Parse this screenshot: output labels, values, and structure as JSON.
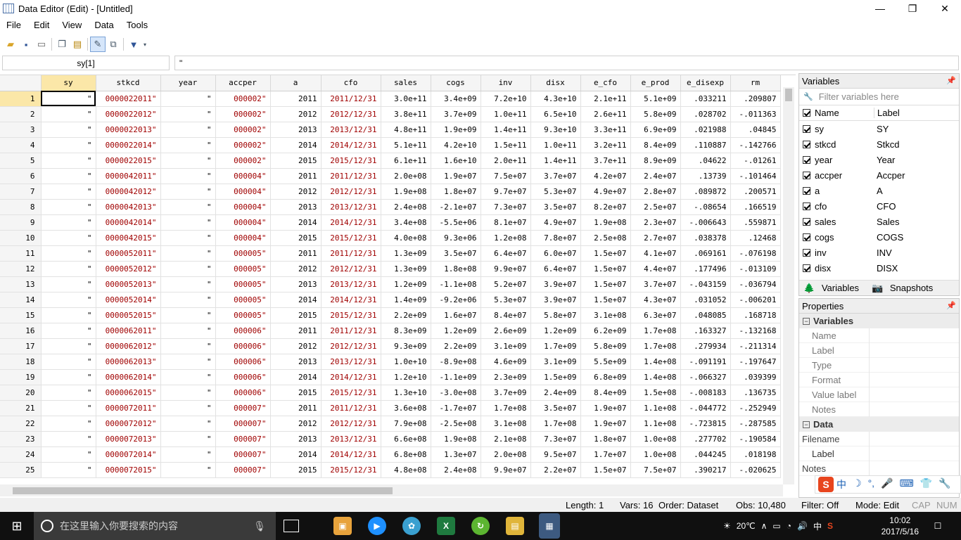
{
  "window": {
    "title": "Data Editor (Edit) - [Untitled]",
    "controls": [
      "—",
      "❐",
      "✕"
    ]
  },
  "menu": [
    "File",
    "Edit",
    "View",
    "Data",
    "Tools"
  ],
  "cellbar": {
    "name": "sy[1]",
    "value": "\""
  },
  "grid": {
    "columns": [
      "sy",
      "stkcd",
      "year",
      "accper",
      "a",
      "cfo",
      "sales",
      "cogs",
      "inv",
      "disx",
      "e_cfo",
      "e_prod",
      "e_disexp",
      "rm"
    ],
    "rows": [
      [
        "1",
        "\"",
        "0000022011\"",
        "\"",
        "000002\"",
        "2011",
        "2011/12/31",
        "3.0e+11",
        "3.4e+09",
        "7.2e+10",
        "4.3e+10",
        "2.1e+11",
        "5.1e+09",
        ".033211",
        ".209807"
      ],
      [
        "2",
        "\"",
        "0000022012\"",
        "\"",
        "000002\"",
        "2012",
        "2012/12/31",
        "3.8e+11",
        "3.7e+09",
        "1.0e+11",
        "6.5e+10",
        "2.6e+11",
        "5.8e+09",
        ".028702",
        "-.011363"
      ],
      [
        "3",
        "\"",
        "0000022013\"",
        "\"",
        "000002\"",
        "2013",
        "2013/12/31",
        "4.8e+11",
        "1.9e+09",
        "1.4e+11",
        "9.3e+10",
        "3.3e+11",
        "6.9e+09",
        ".021988",
        ".04845"
      ],
      [
        "4",
        "\"",
        "0000022014\"",
        "\"",
        "000002\"",
        "2014",
        "2014/12/31",
        "5.1e+11",
        "4.2e+10",
        "1.5e+11",
        "1.0e+11",
        "3.2e+11",
        "8.4e+09",
        ".110887",
        "-.142766"
      ],
      [
        "5",
        "\"",
        "0000022015\"",
        "\"",
        "000002\"",
        "2015",
        "2015/12/31",
        "6.1e+11",
        "1.6e+10",
        "2.0e+11",
        "1.4e+11",
        "3.7e+11",
        "8.9e+09",
        ".04622",
        "-.01261"
      ],
      [
        "6",
        "\"",
        "0000042011\"",
        "\"",
        "000004\"",
        "2011",
        "2011/12/31",
        "2.0e+08",
        "1.9e+07",
        "7.5e+07",
        "3.7e+07",
        "4.2e+07",
        "2.4e+07",
        ".13739",
        "-.101464"
      ],
      [
        "7",
        "\"",
        "0000042012\"",
        "\"",
        "000004\"",
        "2012",
        "2012/12/31",
        "1.9e+08",
        "1.8e+07",
        "9.7e+07",
        "5.3e+07",
        "4.9e+07",
        "2.8e+07",
        ".089872",
        ".200571"
      ],
      [
        "8",
        "\"",
        "0000042013\"",
        "\"",
        "000004\"",
        "2013",
        "2013/12/31",
        "2.4e+08",
        "-2.1e+07",
        "7.3e+07",
        "3.5e+07",
        "8.2e+07",
        "2.5e+07",
        "-.08654",
        ".166519"
      ],
      [
        "9",
        "\"",
        "0000042014\"",
        "\"",
        "000004\"",
        "2014",
        "2014/12/31",
        "3.4e+08",
        "-5.5e+06",
        "8.1e+07",
        "4.9e+07",
        "1.9e+08",
        "2.3e+07",
        "-.006643",
        ".559871"
      ],
      [
        "10",
        "\"",
        "0000042015\"",
        "\"",
        "000004\"",
        "2015",
        "2015/12/31",
        "4.0e+08",
        "9.3e+06",
        "1.2e+08",
        "7.8e+07",
        "2.5e+08",
        "2.7e+07",
        ".038378",
        ".12468"
      ],
      [
        "11",
        "\"",
        "0000052011\"",
        "\"",
        "000005\"",
        "2011",
        "2011/12/31",
        "1.3e+09",
        "3.5e+07",
        "6.4e+07",
        "6.0e+07",
        "1.5e+07",
        "4.1e+07",
        ".069161",
        "-.076198"
      ],
      [
        "12",
        "\"",
        "0000052012\"",
        "\"",
        "000005\"",
        "2012",
        "2012/12/31",
        "1.3e+09",
        "1.8e+08",
        "9.9e+07",
        "6.4e+07",
        "1.5e+07",
        "4.4e+07",
        ".177496",
        "-.013109"
      ],
      [
        "13",
        "\"",
        "0000052013\"",
        "\"",
        "000005\"",
        "2013",
        "2013/12/31",
        "1.2e+09",
        "-1.1e+08",
        "5.2e+07",
        "3.9e+07",
        "1.5e+07",
        "3.7e+07",
        "-.043159",
        "-.036794"
      ],
      [
        "14",
        "\"",
        "0000052014\"",
        "\"",
        "000005\"",
        "2014",
        "2014/12/31",
        "1.4e+09",
        "-9.2e+06",
        "5.3e+07",
        "3.9e+07",
        "1.5e+07",
        "4.3e+07",
        ".031052",
        "-.006201"
      ],
      [
        "15",
        "\"",
        "0000052015\"",
        "\"",
        "000005\"",
        "2015",
        "2015/12/31",
        "2.2e+09",
        "1.6e+07",
        "8.4e+07",
        "5.8e+07",
        "3.1e+08",
        "6.3e+07",
        ".048085",
        ".168718"
      ],
      [
        "16",
        "\"",
        "0000062011\"",
        "\"",
        "000006\"",
        "2011",
        "2011/12/31",
        "8.3e+09",
        "1.2e+09",
        "2.6e+09",
        "1.2e+09",
        "6.2e+09",
        "1.7e+08",
        ".163327",
        "-.132168"
      ],
      [
        "17",
        "\"",
        "0000062012\"",
        "\"",
        "000006\"",
        "2012",
        "2012/12/31",
        "9.3e+09",
        "2.2e+09",
        "3.1e+09",
        "1.7e+09",
        "5.8e+09",
        "1.7e+08",
        ".279934",
        "-.211314"
      ],
      [
        "18",
        "\"",
        "0000062013\"",
        "\"",
        "000006\"",
        "2013",
        "2013/12/31",
        "1.0e+10",
        "-8.9e+08",
        "4.6e+09",
        "3.1e+09",
        "5.5e+09",
        "1.4e+08",
        "-.091191",
        "-.197647"
      ],
      [
        "19",
        "\"",
        "0000062014\"",
        "\"",
        "000006\"",
        "2014",
        "2014/12/31",
        "1.2e+10",
        "-1.1e+09",
        "2.3e+09",
        "1.5e+09",
        "6.8e+09",
        "1.4e+08",
        "-.066327",
        ".039399"
      ],
      [
        "20",
        "\"",
        "0000062015\"",
        "\"",
        "000006\"",
        "2015",
        "2015/12/31",
        "1.3e+10",
        "-3.0e+08",
        "3.7e+09",
        "2.4e+09",
        "8.4e+09",
        "1.5e+08",
        "-.008183",
        ".136735"
      ],
      [
        "21",
        "\"",
        "0000072011\"",
        "\"",
        "000007\"",
        "2011",
        "2011/12/31",
        "3.6e+08",
        "-1.7e+07",
        "1.7e+08",
        "3.5e+07",
        "1.9e+07",
        "1.1e+08",
        "-.044772",
        "-.252949"
      ],
      [
        "22",
        "\"",
        "0000072012\"",
        "\"",
        "000007\"",
        "2012",
        "2012/12/31",
        "7.9e+08",
        "-2.5e+08",
        "3.1e+08",
        "1.7e+08",
        "1.9e+07",
        "1.1e+08",
        "-.723815",
        "-.287585"
      ],
      [
        "23",
        "\"",
        "0000072013\"",
        "\"",
        "000007\"",
        "2013",
        "2013/12/31",
        "6.6e+08",
        "1.9e+08",
        "2.1e+08",
        "7.3e+07",
        "1.8e+07",
        "1.0e+08",
        ".277702",
        "-.190584"
      ],
      [
        "24",
        "\"",
        "0000072014\"",
        "\"",
        "000007\"",
        "2014",
        "2014/12/31",
        "6.8e+08",
        "1.3e+07",
        "2.0e+08",
        "9.5e+07",
        "1.7e+07",
        "1.0e+08",
        ".044245",
        ".018198"
      ],
      [
        "25",
        "\"",
        "0000072015\"",
        "\"",
        "000007\"",
        "2015",
        "2015/12/31",
        "4.8e+08",
        "2.4e+08",
        "9.9e+07",
        "2.2e+07",
        "1.5e+07",
        "7.5e+07",
        ".390217",
        "-.020625"
      ]
    ]
  },
  "variables_panel": {
    "title": "Variables",
    "filter_placeholder": "Filter variables here",
    "header_name": "Name",
    "header_label": "Label",
    "items": [
      {
        "name": "sy",
        "label": "SY"
      },
      {
        "name": "stkcd",
        "label": "Stkcd"
      },
      {
        "name": "year",
        "label": "Year"
      },
      {
        "name": "accper",
        "label": "Accper"
      },
      {
        "name": "a",
        "label": "A"
      },
      {
        "name": "cfo",
        "label": "CFO"
      },
      {
        "name": "sales",
        "label": "Sales"
      },
      {
        "name": "cogs",
        "label": "COGS"
      },
      {
        "name": "inv",
        "label": "INV"
      },
      {
        "name": "disx",
        "label": "DISX"
      }
    ],
    "tabs": [
      "Variables",
      "Snapshots"
    ]
  },
  "properties_panel": {
    "title": "Properties",
    "sections": [
      {
        "title": "Variables",
        "rows": [
          "Name",
          "Label",
          "Type",
          "Format",
          "Value label",
          "Notes"
        ]
      },
      {
        "title": "Data",
        "rows": [
          "Filename",
          "Label",
          "Notes"
        ]
      }
    ]
  },
  "status": {
    "length": "Length: 1",
    "vars": "Vars: 16",
    "order": "Order: Dataset",
    "obs": "Obs: 10,480",
    "filter": "Filter: Off",
    "mode": "Mode: Edit",
    "cap": "CAP",
    "num": "NUM"
  },
  "taskbar": {
    "search_placeholder": "在这里输入你要搜索的内容",
    "temperature": "20℃",
    "ime_lang": "中",
    "time": "10:02",
    "date": "2017/5/16"
  },
  "ime_bar": {
    "brand": "S",
    "items": [
      "中",
      "☽",
      "°,",
      "🎤",
      "⌨",
      "👕",
      "🔧"
    ]
  }
}
